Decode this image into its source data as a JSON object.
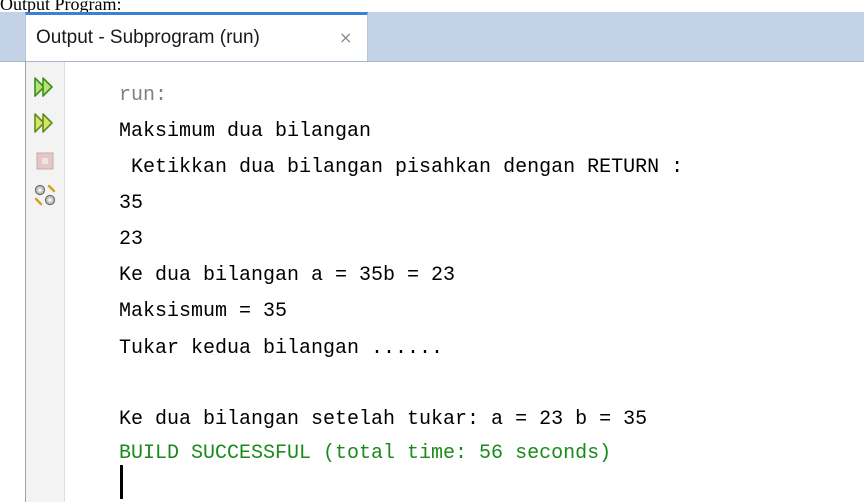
{
  "caption": "Output Program:",
  "tab": {
    "title": "Output - Subprogram (run)",
    "close_glyph": "×"
  },
  "toolbar": {
    "buttons": [
      {
        "name": "rerun-icon"
      },
      {
        "name": "rerun-with-customized-icon"
      },
      {
        "name": "stop-icon"
      },
      {
        "name": "settings-icon"
      }
    ]
  },
  "console": {
    "lines": [
      {
        "text": "run:",
        "color": "#808080"
      },
      {
        "text": "Maksimum dua bilangan",
        "color": "#000000"
      },
      {
        "text": " Ketikkan dua bilangan pisahkan dengan RETURN :",
        "color": "#000000"
      },
      {
        "text": "35",
        "color": "#000000"
      },
      {
        "text": "23",
        "color": "#000000"
      },
      {
        "text": "Ke dua bilangan a = 35b = 23",
        "color": "#000000"
      },
      {
        "text": "Maksismum = 35",
        "color": "#000000"
      },
      {
        "text": "Tukar kedua bilangan ......",
        "color": "#000000"
      },
      {
        "text": "",
        "color": "#000000"
      },
      {
        "text": "Ke dua bilangan setelah tukar: a = 23 b = 35",
        "color": "#000000"
      },
      {
        "text": "BUILD SUCCESSFUL (total time: 56 seconds)",
        "color": "#1a8a1a"
      }
    ]
  }
}
